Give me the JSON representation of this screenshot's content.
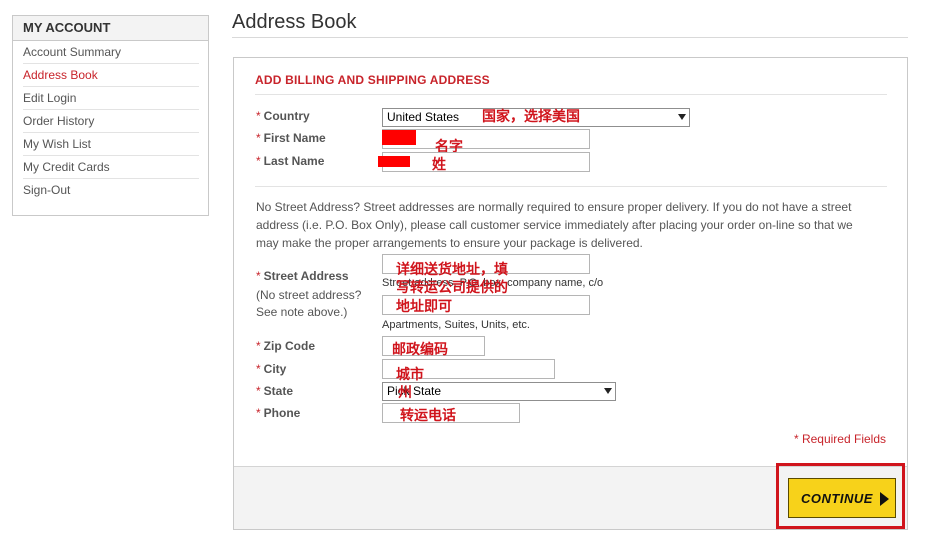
{
  "sidebar": {
    "title": "MY ACCOUNT",
    "items": [
      {
        "label": "Account Summary"
      },
      {
        "label": "Address Book"
      },
      {
        "label": "Edit Login"
      },
      {
        "label": "Order History"
      },
      {
        "label": "My Wish List"
      },
      {
        "label": "My Credit Cards"
      },
      {
        "label": "Sign-Out"
      }
    ],
    "active_index": 1
  },
  "page": {
    "title": "Address Book"
  },
  "form": {
    "section_title": "ADD BILLING AND SHIPPING ADDRESS",
    "required_marker": "*",
    "country": {
      "label": "Country",
      "value": "United States",
      "annotation": "国家，选择美国"
    },
    "first_name": {
      "label": "First Name",
      "annotation": "名字"
    },
    "last_name": {
      "label": "Last Name",
      "annotation": "姓"
    },
    "note": "No Street Address? Street addresses are normally required to ensure proper delivery. If you do not have a street address (i.e. P.O. Box Only), please call customer service immediately after placing your order on-line so that we may make the proper arrangements to ensure your package is delivered.",
    "street": {
      "label": "Street Address",
      "sublabel_1": "(No street address?",
      "sublabel_2": "See note above.)",
      "hint_1": "Street address, P.O. box, company name, c/o",
      "hint_2": "Apartments, Suites, Units, etc.",
      "annotation_1": "详细送货地址，填",
      "annotation_2": "写转运公司提供的",
      "annotation_3": "地址即可"
    },
    "zip": {
      "label": "Zip Code",
      "annotation": "邮政编码"
    },
    "city": {
      "label": "City",
      "annotation": "城市"
    },
    "state": {
      "label": "State",
      "value": "Pick State",
      "annotation": "州"
    },
    "phone": {
      "label": "Phone",
      "annotation": "转运电话"
    },
    "required_fields": "* Required Fields"
  },
  "actions": {
    "continue_label": "CONTINUE"
  },
  "colors": {
    "accent_red": "#c8242b",
    "button_yellow": "#f7d21a",
    "annotation_red": "#d0141c"
  }
}
